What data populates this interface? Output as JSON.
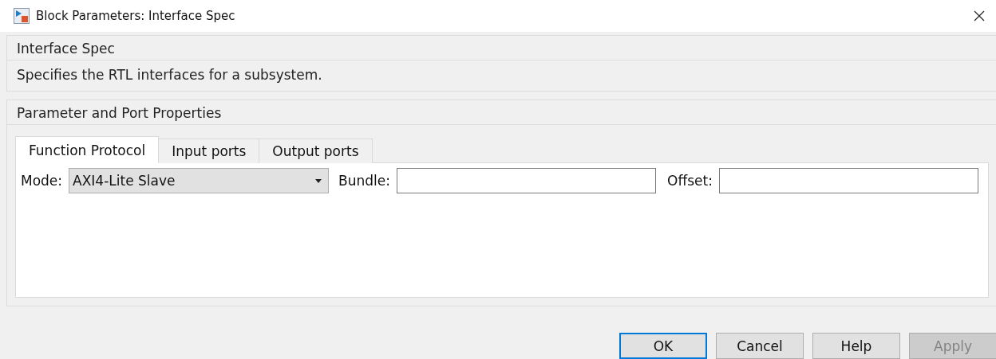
{
  "window": {
    "title": "Block Parameters: Interface Spec"
  },
  "description_group": {
    "title": "Interface Spec",
    "text": "Specifies the RTL interfaces for a subsystem."
  },
  "parameters_group": {
    "title": "Parameter and Port Properties"
  },
  "tabs": [
    {
      "label": "Function Protocol",
      "selected": true
    },
    {
      "label": "Input ports",
      "selected": false
    },
    {
      "label": "Output ports",
      "selected": false
    }
  ],
  "fields": [
    {
      "kind": "dropdown",
      "label": "Mode:",
      "value": "AXI4-Lite Slave"
    },
    {
      "kind": "text",
      "label": "Bundle:"
    },
    {
      "kind": "text",
      "label": "Offset:"
    }
  ],
  "buttons": [
    {
      "label": "OK",
      "default": true,
      "disabled": false
    },
    {
      "label": "Cancel",
      "default": false,
      "disabled": false
    },
    {
      "label": "Help",
      "default": false,
      "disabled": false
    },
    {
      "label": "Apply",
      "default": false,
      "disabled": true
    }
  ]
}
